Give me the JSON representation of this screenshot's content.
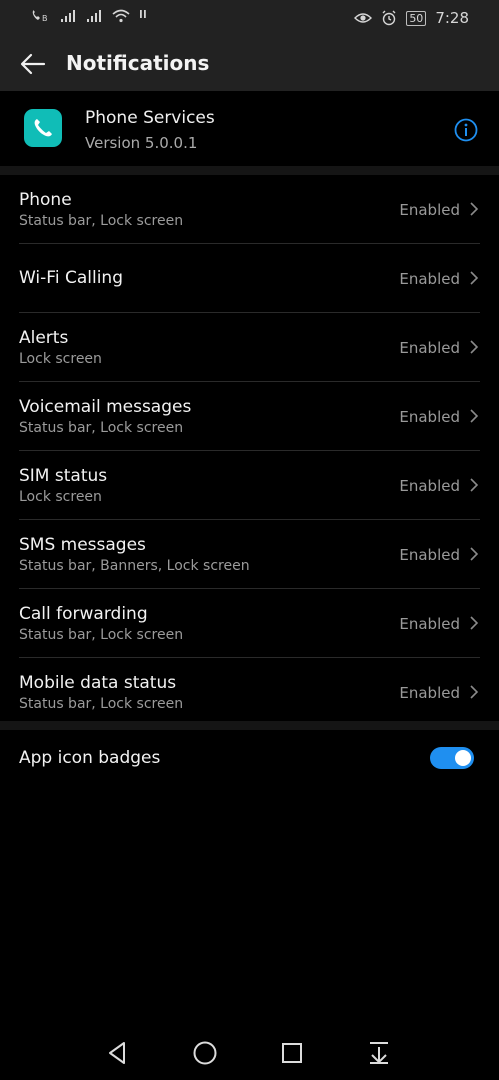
{
  "status_bar": {
    "time": "7:28",
    "battery": "50",
    "left_icons": [
      "call-hd-icon",
      "signal-icon",
      "signal-icon",
      "wifi-icon",
      "alert-icon"
    ],
    "right_icons": [
      "eye-icon",
      "alarm-icon",
      "battery-icon"
    ]
  },
  "appbar": {
    "title": "Notifications"
  },
  "app": {
    "name": "Phone Services",
    "version": "Version 5.0.0.1",
    "icon_color": "#10bdb7",
    "accent": "#1f8ff0"
  },
  "channels": [
    {
      "title": "Phone",
      "subtitle": "Status bar, Lock screen",
      "status": "Enabled"
    },
    {
      "title": "Wi-Fi Calling",
      "subtitle": "",
      "status": "Enabled"
    },
    {
      "title": "Alerts",
      "subtitle": "Lock screen",
      "status": "Enabled"
    },
    {
      "title": "Voicemail messages",
      "subtitle": "Status bar, Lock screen",
      "status": "Enabled"
    },
    {
      "title": "SIM status",
      "subtitle": "Lock screen",
      "status": "Enabled"
    },
    {
      "title": "SMS messages",
      "subtitle": "Status bar, Banners, Lock screen",
      "status": "Enabled"
    },
    {
      "title": "Call forwarding",
      "subtitle": "Status bar, Lock screen",
      "status": "Enabled"
    },
    {
      "title": "Mobile data status",
      "subtitle": "Status bar, Lock screen",
      "status": "Enabled"
    }
  ],
  "badges": {
    "label": "App icon badges",
    "enabled": true
  },
  "nav": [
    "back-icon",
    "home-icon",
    "recents-icon",
    "notification-shade-icon"
  ]
}
